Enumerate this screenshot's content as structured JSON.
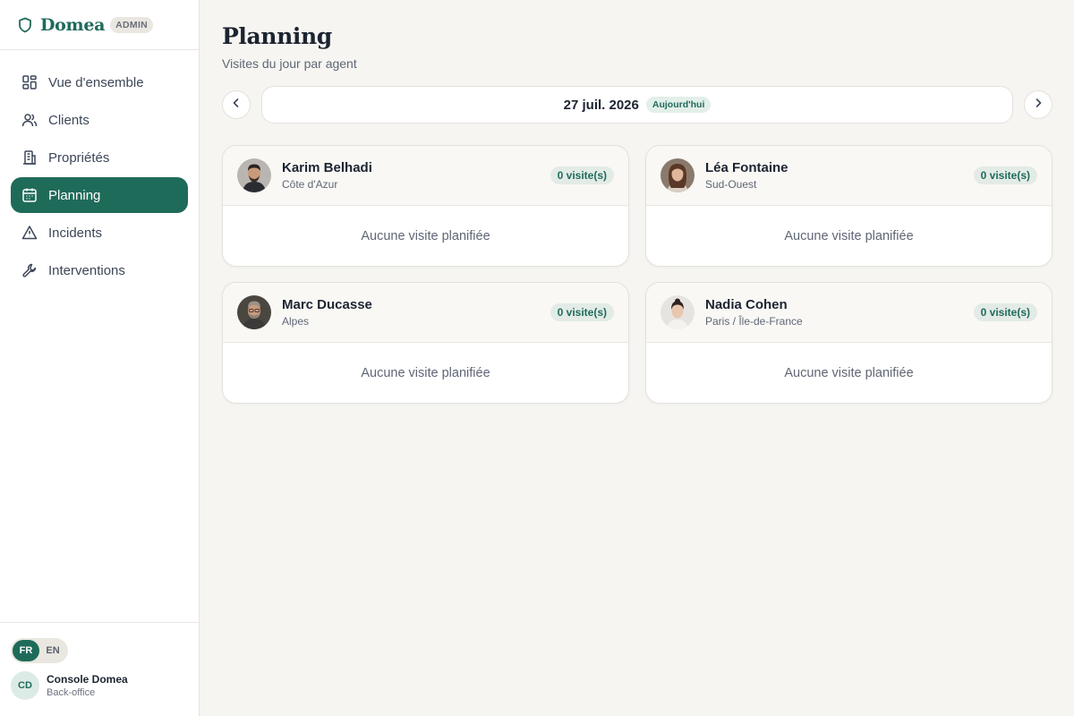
{
  "app": {
    "name": "Domea",
    "badge": "ADMIN"
  },
  "sidebar": {
    "items": [
      {
        "label": "Vue d'ensemble",
        "icon": "dashboard-icon"
      },
      {
        "label": "Clients",
        "icon": "users-icon"
      },
      {
        "label": "Propriétés",
        "icon": "building-icon"
      },
      {
        "label": "Planning",
        "icon": "calendar-icon",
        "active": true
      },
      {
        "label": "Incidents",
        "icon": "warning-icon"
      },
      {
        "label": "Interventions",
        "icon": "wrench-icon"
      }
    ],
    "languages": [
      "FR",
      "EN"
    ],
    "active_language": "FR",
    "user": {
      "initials": "CD",
      "name": "Console Domea",
      "role": "Back-office"
    }
  },
  "page": {
    "title": "Planning",
    "subtitle": "Visites du jour par agent"
  },
  "date_nav": {
    "date": "27 juil. 2026",
    "today_label": "Aujourd'hui"
  },
  "agents": [
    {
      "name": "Karim Belhadi",
      "region": "Côte d'Azur",
      "visits": "0 visite(s)",
      "empty": "Aucune visite planifiée"
    },
    {
      "name": "Léa Fontaine",
      "region": "Sud-Ouest",
      "visits": "0 visite(s)",
      "empty": "Aucune visite planifiée"
    },
    {
      "name": "Marc Ducasse",
      "region": "Alpes",
      "visits": "0 visite(s)",
      "empty": "Aucune visite planifiée"
    },
    {
      "name": "Nadia Cohen",
      "region": "Paris / Île-de-France",
      "visits": "0 visite(s)",
      "empty": "Aucune visite planifiée"
    }
  ],
  "colors": {
    "accent": "#1f6b5a",
    "background": "#f6f5f1",
    "sidebar": "#ffffff"
  }
}
